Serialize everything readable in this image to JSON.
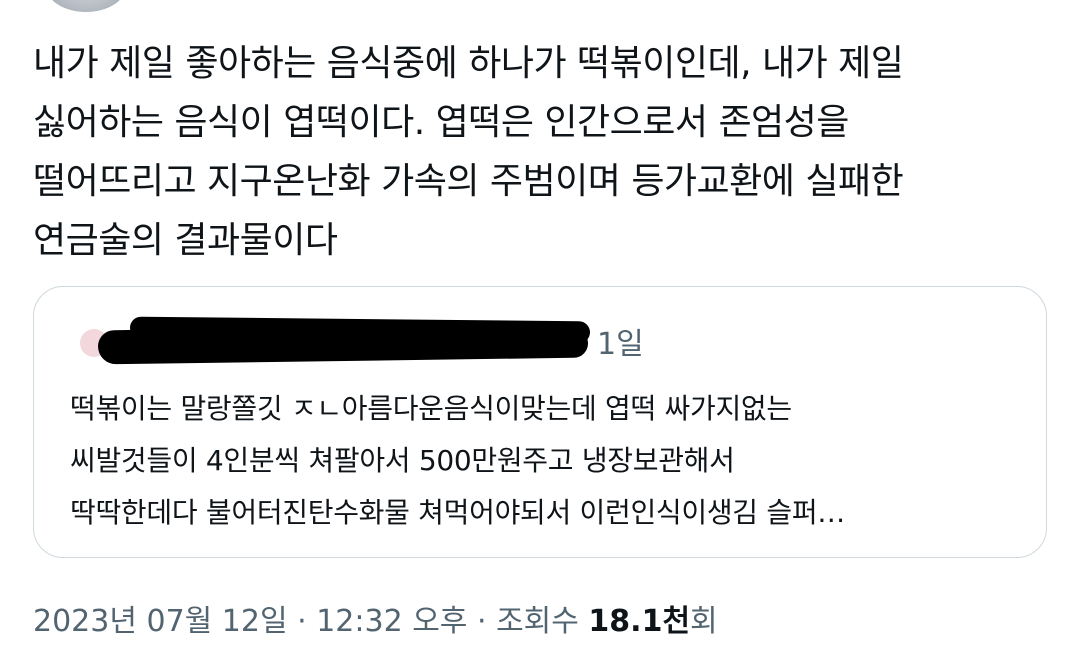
{
  "tweet": {
    "lines": [
      "내가 제일 좋아하는 음식중에 하나가 떡볶이인데, 내가 제일",
      "싫어하는 음식이 엽떡이다. 엽떡은 인간으로서 존엄성을",
      "떨어뜨리고 지구온난화 가속의 주범이며 등가교환에 실패한",
      "연금술의 결과물이다"
    ]
  },
  "quote": {
    "time": "1일",
    "lines": [
      "떡볶이는 말랑쫄깃 ㅈㄴ아름다운음식이맞는데 엽떡 싸가지없는",
      "씨발것들이 4인분씩 쳐팔아서 500만원주고 냉장보관해서",
      "딱딱한데다 불어터진탄수화물 쳐먹어야되서 이런인식이생김 슬퍼…"
    ]
  },
  "meta": {
    "date": "2023년 07월 12일",
    "separator": "·",
    "time": "12:32 오후",
    "views_label": "조회수",
    "views_count": "18.1천",
    "views_suffix": "회"
  },
  "colors": {
    "text": "#0f1419",
    "secondary": "#536471",
    "border": "#cfd9de"
  }
}
